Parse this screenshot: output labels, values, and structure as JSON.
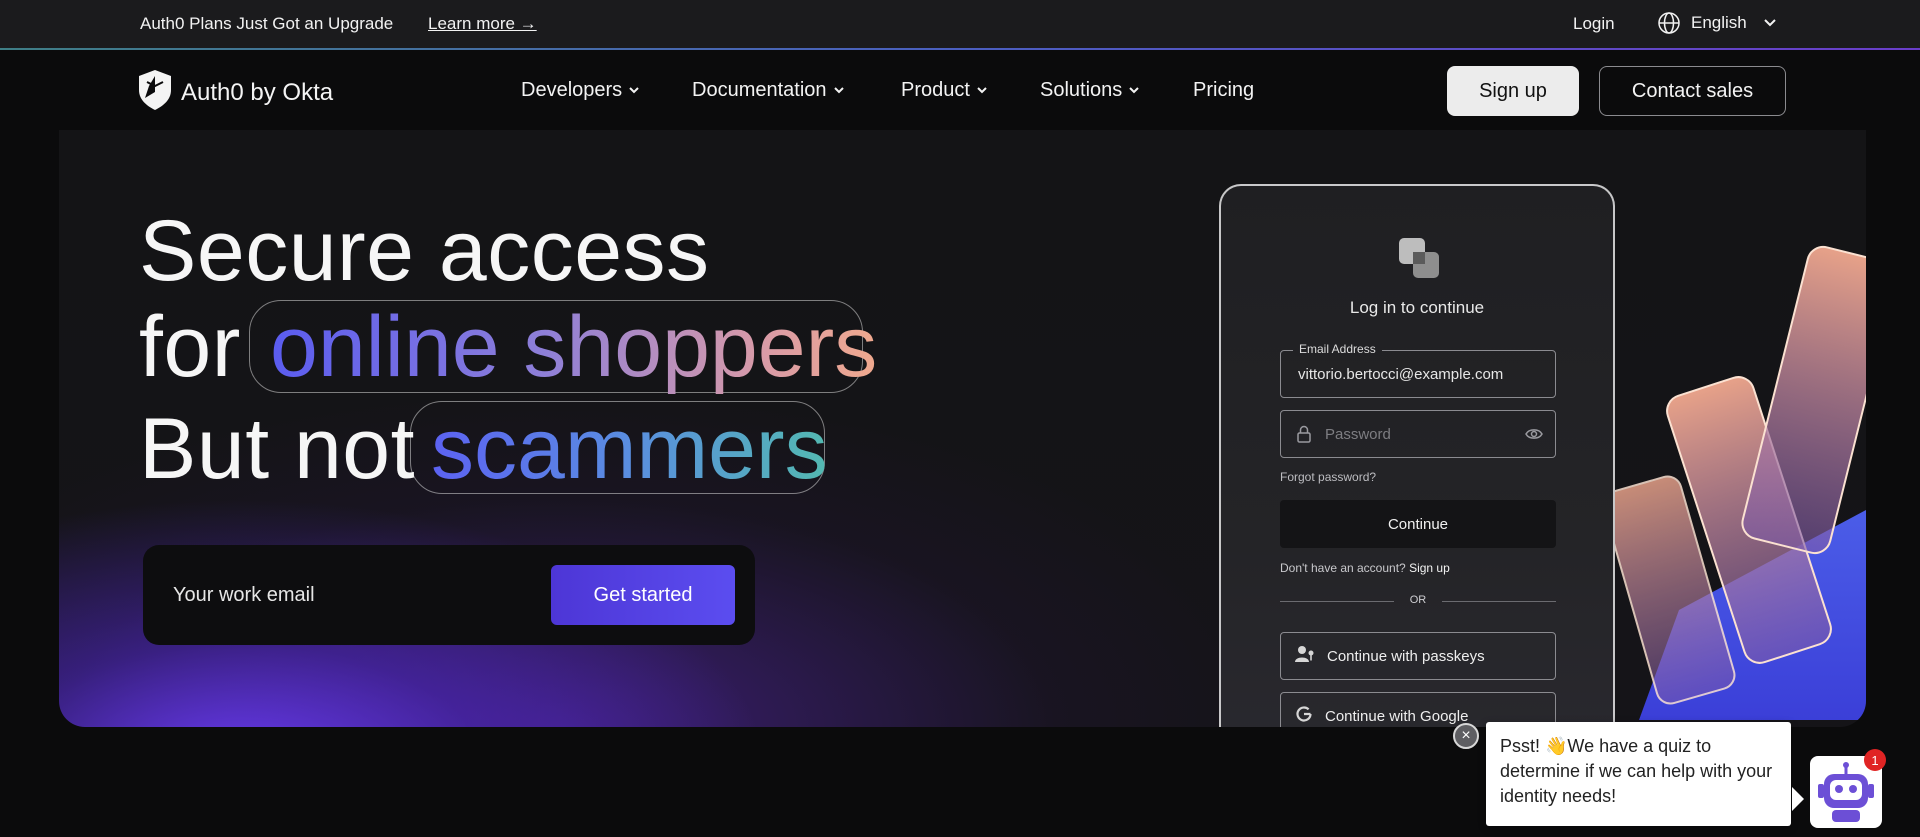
{
  "topbar": {
    "announcement": "Auth0 Plans Just Got an Upgrade",
    "learn_more": "Learn more →",
    "login": "Login",
    "language": "English"
  },
  "nav": {
    "logo_text": "Auth0 by Okta",
    "items": [
      {
        "label": "Developers",
        "has_dropdown": true
      },
      {
        "label": "Documentation",
        "has_dropdown": true
      },
      {
        "label": "Product",
        "has_dropdown": true
      },
      {
        "label": "Solutions",
        "has_dropdown": true
      },
      {
        "label": "Pricing",
        "has_dropdown": false
      }
    ],
    "signup": "Sign up",
    "contact_sales": "Contact sales"
  },
  "hero": {
    "line1": "Secure access",
    "line2_prefix": "for",
    "line2_highlight": "online shoppers",
    "line3_prefix": "But not",
    "line3_highlight": "scammers",
    "email_placeholder": "Your work email",
    "cta": "Get started"
  },
  "login_card": {
    "title": "Log in to continue",
    "email_label": "Email Address",
    "email_value": "vittorio.bertocci@example.com",
    "password_placeholder": "Password",
    "forgot": "Forgot password?",
    "continue": "Continue",
    "no_account": "Don't have an account?",
    "signup_link": "Sign up",
    "or": "OR",
    "passkeys": "Continue with passkeys",
    "google": "Continue with Google"
  },
  "chat": {
    "message": "Psst! 👋We have a quiz to determine if we can help with your identity needs!",
    "badge_count": "1",
    "close": "×"
  },
  "colors": {
    "accent": "#5b4df0",
    "background": "#0b0b0c",
    "badge": "#e02424"
  }
}
